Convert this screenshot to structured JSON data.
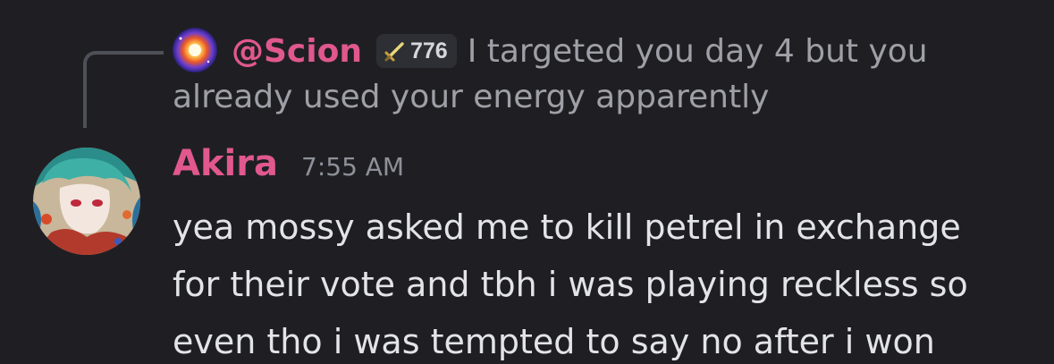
{
  "colors": {
    "background": "#1f1f23",
    "username": "#e0588e",
    "muted_text": "#9fa0a7",
    "message_text": "#e3e4e8",
    "reply_spine": "#4e5058",
    "badge_bg": "#2e2f35"
  },
  "reply": {
    "avatar_icon": "scion-avatar",
    "username": "@Scion",
    "badge_icon": "sword-icon",
    "badge_count": "776",
    "text_line1": "I targeted you day 4 but you",
    "text_line2": "already used your energy apparently"
  },
  "message": {
    "avatar_icon": "akira-avatar",
    "author": "Akira",
    "timestamp": "7:55 AM",
    "lines": [
      "yea mossy asked me to kill petrel in exchange",
      "for their vote and tbh i was playing reckless so",
      "even tho i was tempted to say no after i won"
    ]
  }
}
